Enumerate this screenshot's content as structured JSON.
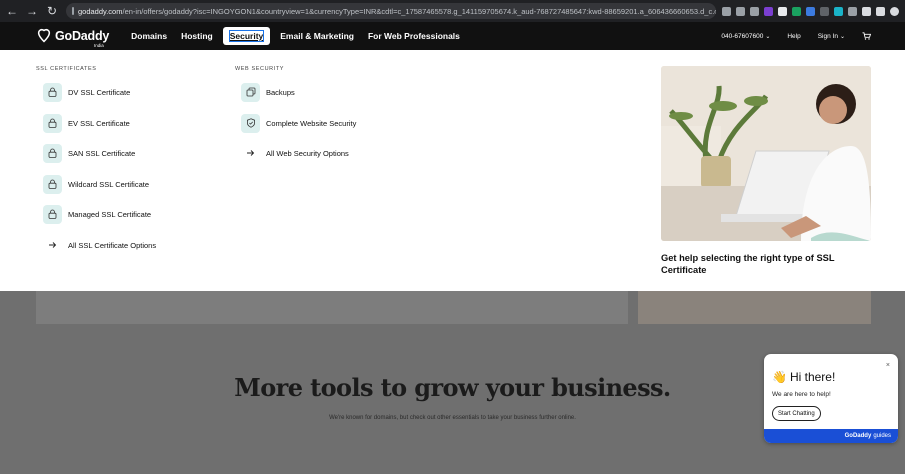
{
  "browser": {
    "url_host": "godaddy.com",
    "url_rest": "/en-in/offers/godaddy?isc=INGOYGON1&countryview=1&currencyType=INR&cdtl=c_17587465578.g_141159705674.k_aud-768727485647:kwd-88659201.a_606436660653.d_c.ctv_g..."
  },
  "header": {
    "logo_text": "GoDaddy",
    "logo_sub": "India",
    "nav": [
      "Domains",
      "Hosting",
      "Security",
      "Email & Marketing",
      "For Web Professionals"
    ],
    "active_nav": "Security",
    "phone": "040-67607600",
    "help": "Help",
    "sign_in": "Sign In"
  },
  "menu": {
    "ssl_title": "SSL CERTIFICATES",
    "ssl_items": [
      {
        "label": "DV SSL Certificate",
        "icon": "lock-icon"
      },
      {
        "label": "EV SSL Certificate",
        "icon": "lock-icon"
      },
      {
        "label": "SAN SSL Certificate",
        "icon": "lock-icon"
      },
      {
        "label": "Wildcard SSL Certificate",
        "icon": "lock-icon"
      },
      {
        "label": "Managed SSL Certificate",
        "icon": "lock-icon"
      },
      {
        "label": "All SSL Certificate Options",
        "icon": "arrow-right-icon"
      }
    ],
    "web_title": "WEB SECURITY",
    "web_items": [
      {
        "label": "Backups",
        "icon": "copy-icon"
      },
      {
        "label": "Complete Website Security",
        "icon": "shield-icon"
      },
      {
        "label": "All Web Security Options",
        "icon": "arrow-right-icon"
      }
    ],
    "promo_text": "Get help selecting the right type of SSL Certificate"
  },
  "page_behind": {
    "heading": "More tools to grow your business.",
    "subheading": "We're known for domains, but check out other essentials to take your business further online."
  },
  "chat": {
    "title": "Hi there!",
    "emoji": "👋",
    "subtitle": "We are here to help!",
    "button": "Start Chatting",
    "footer_brand": "GoDaddy",
    "footer_suffix": "guides"
  },
  "colors": {
    "header_bg": "#111111",
    "icon_tile": "#dcefee",
    "chat_footer": "#1a4fd6"
  }
}
